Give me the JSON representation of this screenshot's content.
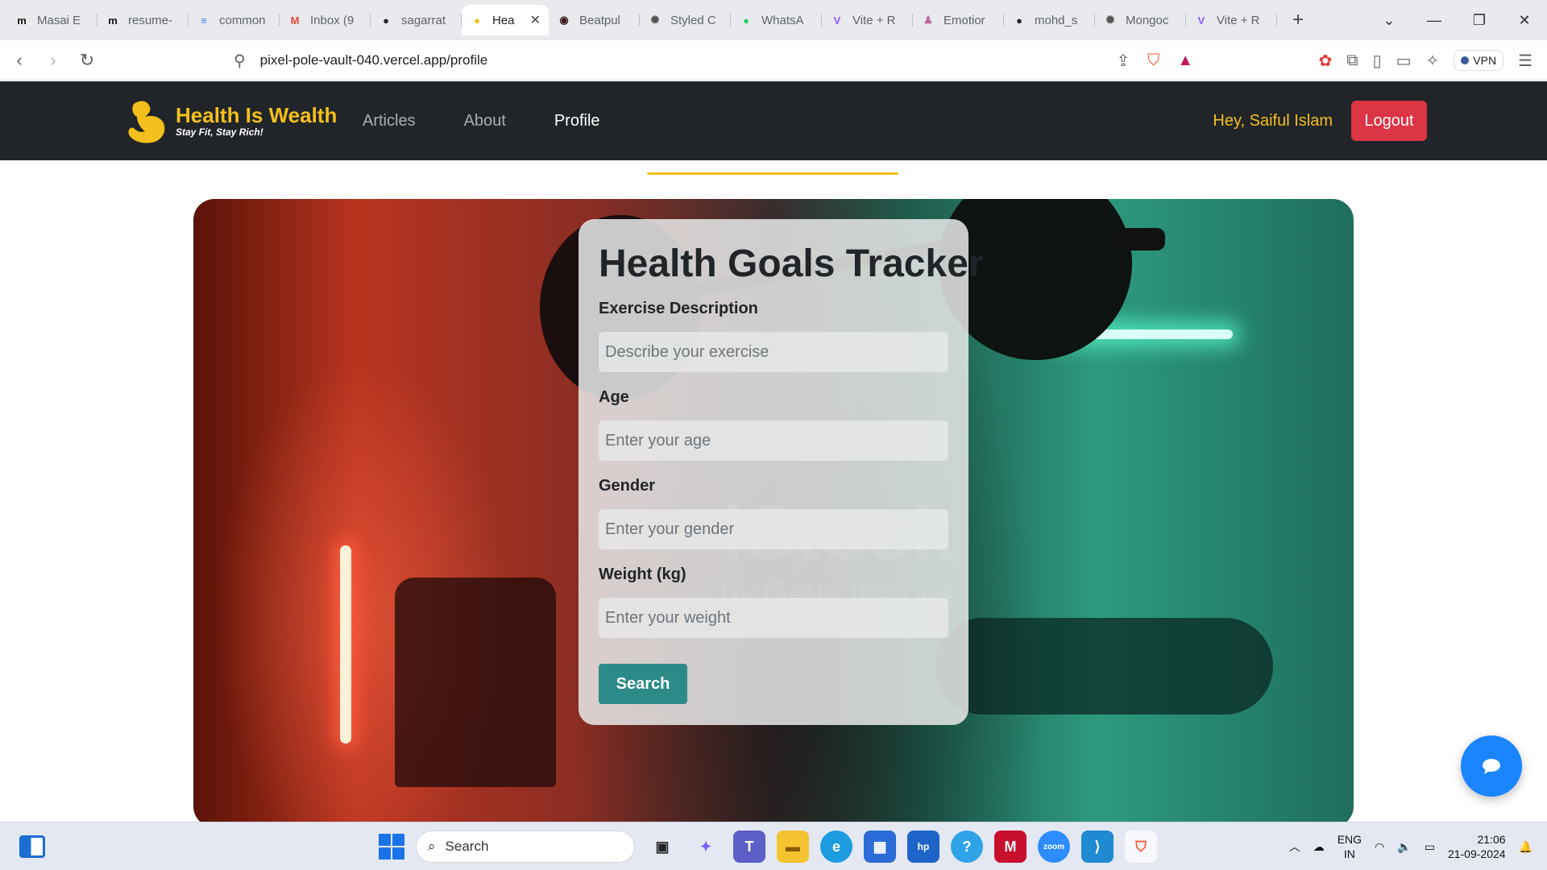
{
  "browser": {
    "tabs": [
      {
        "title": "Masai E",
        "favicon": "m",
        "color": "#111111"
      },
      {
        "title": "resume-",
        "favicon": "m",
        "color": "#111111"
      },
      {
        "title": "common",
        "favicon": "≡",
        "color": "#4285f4"
      },
      {
        "title": "Inbox (9",
        "favicon": "M",
        "color": "#ea4335"
      },
      {
        "title": "sagarrat",
        "favicon": "●",
        "color": "#24292f"
      },
      {
        "title": "Hea",
        "favicon": "●",
        "color": "#f4bf1c",
        "active": true
      },
      {
        "title": "Beatpul",
        "favicon": "◉",
        "color": "#3a1a1a"
      },
      {
        "title": "Styled C",
        "favicon": "✺",
        "color": "#555555"
      },
      {
        "title": "WhatsA",
        "favicon": "●",
        "color": "#25d366"
      },
      {
        "title": "Vite + R",
        "favicon": "V",
        "color": "#8b5cf6"
      },
      {
        "title": "Emotior",
        "favicon": "♟",
        "color": "#c06c9a"
      },
      {
        "title": "mohd_s",
        "favicon": "●",
        "color": "#24292f"
      },
      {
        "title": "Mongoc",
        "favicon": "✺",
        "color": "#555555"
      },
      {
        "title": "Vite + R",
        "favicon": "V",
        "color": "#8b5cf6"
      }
    ],
    "new_tab": "+",
    "address": "pixel-pole-vault-040.vercel.app/profile",
    "vpn_label": "VPN"
  },
  "site": {
    "brand_name": "Health Is Wealth",
    "brand_tagline": "Stay Fit, Stay Rich!",
    "nav": [
      "Articles",
      "About",
      "Profile"
    ],
    "active_nav": "Profile",
    "greeting": "Hey, Saiful Islam",
    "logout_label": "Logout",
    "accent_color": "#f4bf1c"
  },
  "hero": {
    "watermark": "iStock",
    "watermark_sub": "by Getty Images"
  },
  "form": {
    "title": "Health Goals Tracker",
    "fields": [
      {
        "label": "Exercise Description",
        "placeholder": "Describe your exercise",
        "value": ""
      },
      {
        "label": "Age",
        "placeholder": "Enter your age",
        "value": ""
      },
      {
        "label": "Gender",
        "placeholder": "Enter your gender",
        "value": ""
      },
      {
        "label": "Weight (kg)",
        "placeholder": "Enter your weight",
        "value": ""
      }
    ],
    "submit_label": "Search",
    "submit_color": "#2c8b88"
  },
  "taskbar": {
    "search_placeholder": "Search",
    "lang_top": "ENG",
    "lang_bottom": "IN",
    "time": "21:06",
    "date": "21-09-2024"
  }
}
